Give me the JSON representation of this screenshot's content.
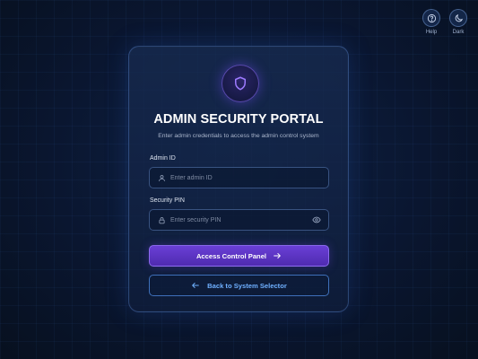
{
  "header": {
    "help_label": "Help",
    "dark_label": "Dark",
    "help_icon": "question-icon",
    "dark_icon": "moon-icon"
  },
  "card": {
    "badge_icon": "shield-icon",
    "title": "ADMIN SECURITY PORTAL",
    "subtitle": "Enter admin credentials to access the admin control system"
  },
  "form": {
    "admin_id": {
      "label": "Admin ID",
      "placeholder": "Enter admin ID",
      "value": "",
      "icon": "user-icon"
    },
    "security_pin": {
      "label": "Security PIN",
      "placeholder": "Enter security PIN",
      "value": "",
      "icon": "lock-icon",
      "toggle_icon": "eye-icon"
    }
  },
  "actions": {
    "primary_label": "Access Control Panel",
    "primary_icon": "arrow-right-icon",
    "secondary_label": "Back to System Selector",
    "secondary_icon": "arrow-left-icon"
  },
  "colors": {
    "accent_purple": "#5b34c4",
    "accent_blue": "#6fb0ff",
    "background": "#0a1630"
  }
}
